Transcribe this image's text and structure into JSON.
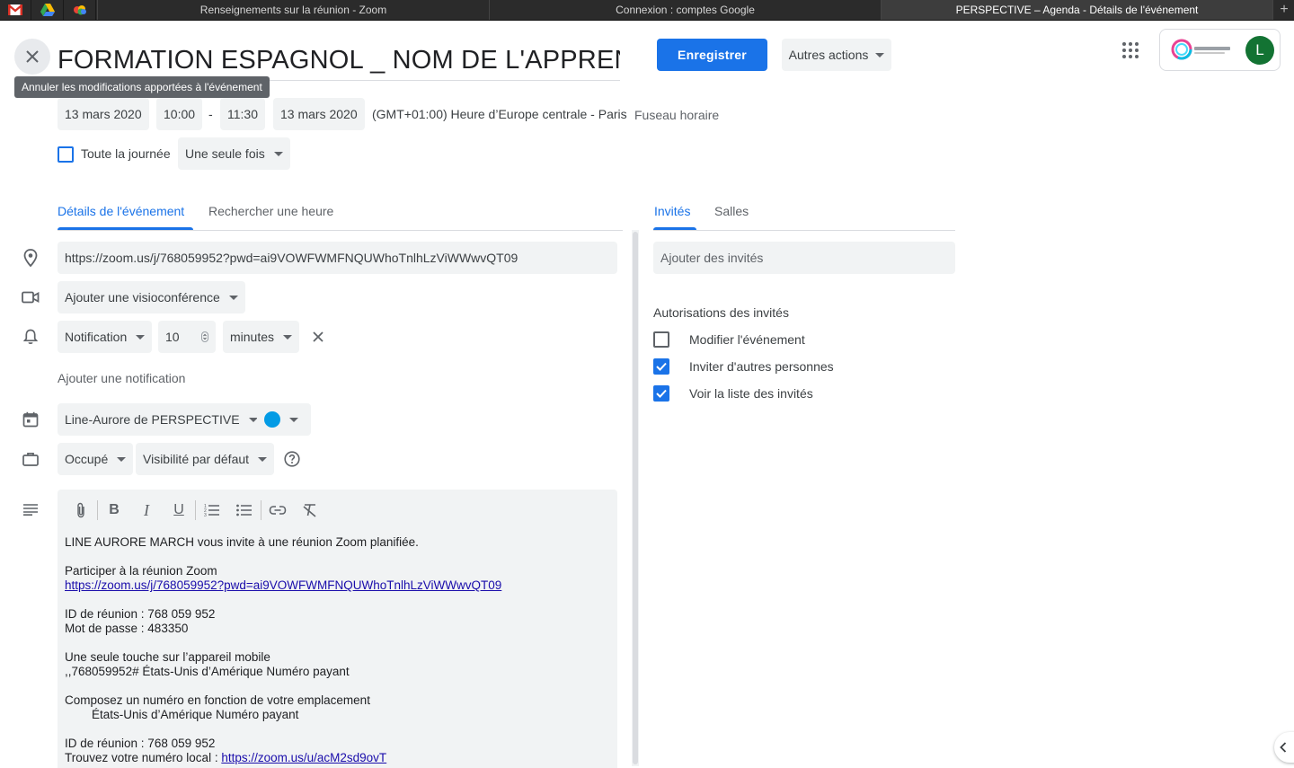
{
  "browser": {
    "tabs": [
      {
        "label": "Renseignements sur la réunion - Zoom",
        "active": false
      },
      {
        "label": "Connexion : comptes Google",
        "active": false
      },
      {
        "label": "PERSPECTIVE – Agenda - Détails de l'événement",
        "active": true
      }
    ],
    "new_tab_label": "+"
  },
  "header": {
    "title": "FORMATION ESPAGNOL _ NOM DE L'APPRENANT",
    "close_tooltip": "Annuler les modifications apportées à l'événement",
    "save_label": "Enregistrer",
    "more_actions_label": "Autres actions",
    "avatar_letter": "L"
  },
  "when": {
    "start_date": "13 mars 2020",
    "start_time": "10:00",
    "separator": "-",
    "end_time": "11:30",
    "end_date": "13 mars 2020",
    "timezone": "(GMT+01:00) Heure d’Europe centrale - Paris",
    "timezone_link": "Fuseau horaire",
    "all_day_label": "Toute la journée",
    "all_day_checked": false,
    "recurrence": "Une seule fois"
  },
  "left_tabs": [
    {
      "label": "Détails de l'événement",
      "active": true
    },
    {
      "label": "Rechercher une heure",
      "active": false
    }
  ],
  "details": {
    "location": "https://zoom.us/j/768059952?pwd=ai9VOWFWMFNQUWhoTnlhLzViWWwvQT09",
    "conference": "Ajouter une visioconférence",
    "notification_type": "Notification",
    "notification_value": "10",
    "notification_unit": "minutes",
    "add_notification": "Ajouter une notification",
    "calendar": "Line-Aurore de PERSPECTIVE",
    "calendar_color": "#039be5",
    "availability": "Occupé",
    "visibility": "Visibilité par défaut"
  },
  "description": {
    "lines": [
      {
        "text": "LINE AURORE MARCH vous invite à une réunion Zoom planifiée."
      },
      {
        "text": ""
      },
      {
        "text": "Participer à la réunion Zoom"
      },
      {
        "text": "https://zoom.us/j/768059952?pwd=ai9VOWFWMFNQUWhoTnlhLzViWWwvQT09",
        "link": true
      },
      {
        "text": ""
      },
      {
        "text": "ID de réunion : 768 059 952"
      },
      {
        "text": "Mot de passe : 483350"
      },
      {
        "text": ""
      },
      {
        "text": "Une seule touche sur l’appareil mobile"
      },
      {
        "text": ",,768059952# États-Unis d’Amérique Numéro payant"
      },
      {
        "text": ""
      },
      {
        "text": "Composez un numéro en fonction de votre emplacement"
      },
      {
        "text": "        États-Unis d’Amérique Numéro payant"
      },
      {
        "text": ""
      },
      {
        "text": "ID de réunion : 768 059 952"
      },
      {
        "text": "Trouvez votre numéro local : ",
        "link_text": "https://zoom.us/u/acM2sd9ovT"
      }
    ]
  },
  "right_tabs": [
    {
      "label": "Invités",
      "active": true
    },
    {
      "label": "Salles",
      "active": false
    }
  ],
  "guests": {
    "add_placeholder": "Ajouter des invités",
    "permissions_title": "Autorisations des invités",
    "permissions": [
      {
        "label": "Modifier l'événement",
        "checked": false
      },
      {
        "label": "Inviter d'autres personnes",
        "checked": true
      },
      {
        "label": "Voir la liste des invités",
        "checked": true
      }
    ]
  },
  "colors": {
    "accent": "#1a73e8",
    "chip_bg": "#f1f3f4",
    "avatar": "#137333",
    "tab_strip": "#2b2b2b"
  }
}
